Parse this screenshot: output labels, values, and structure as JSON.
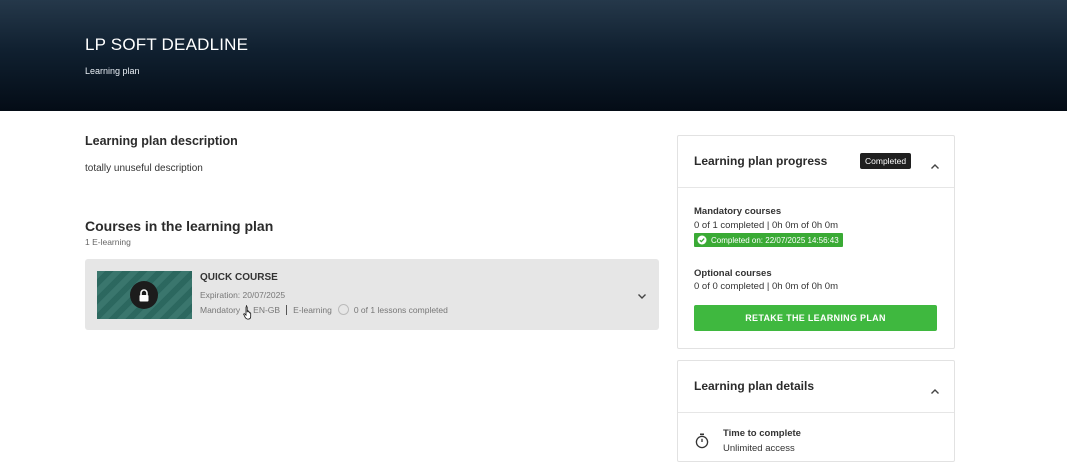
{
  "header": {
    "title": "LP SOFT DEADLINE",
    "subtitle": "Learning plan"
  },
  "description": {
    "heading": "Learning plan description",
    "text": "totally unuseful description"
  },
  "courses": {
    "heading": "Courses in the learning plan",
    "count": "1 E-learning",
    "items": [
      {
        "name": "QUICK COURSE",
        "expiration": "Expiration: 20/07/2025",
        "type": "Mandatory",
        "language": "EN-GB",
        "format": "E-learning",
        "lessons": "0 of 1 lessons completed",
        "thumb_color": "#2e6d64",
        "icon": "lock-icon"
      }
    ]
  },
  "progress": {
    "title": "Learning plan progress",
    "badge": "Completed",
    "mandatory_label": "Mandatory courses",
    "mandatory_value": "0 of 1 completed | 0h 0m of 0h 0m",
    "completed_on": "Completed on: 22/07/2025 14:56:43",
    "optional_label": "Optional courses",
    "optional_value": "0 of 0 completed | 0h 0m of 0h 0m",
    "retake_button": "RETAKE THE LEARNING PLAN",
    "accent_color": "#3fb83f"
  },
  "details": {
    "title": "Learning plan details",
    "time_label": "Time to complete",
    "time_value": "Unlimited access"
  }
}
